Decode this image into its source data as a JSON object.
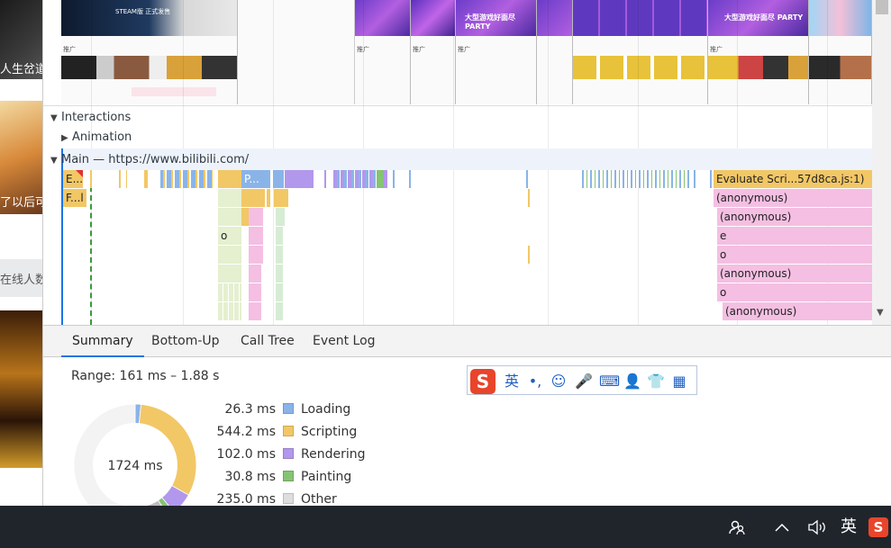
{
  "left_page": {
    "texts": [
      "人生岔道",
      "了以后可",
      "在线人数"
    ]
  },
  "filmstrip": {
    "frames": [
      {
        "banner": "STEAM版 正式发售",
        "tag": "推广"
      },
      {
        "banner": "大型游戏好面尽 PARTY",
        "tag": "推广"
      },
      {
        "banner": "大型游戏好面尽 PARTY",
        "tag": "推广"
      },
      {
        "banner": "大型游戏好面尽 PARTY",
        "tag": "推广"
      },
      {
        "banner": "大型游戏好面尽 PARTY",
        "tag": "推广"
      }
    ]
  },
  "tracks": {
    "interactions": "Interactions",
    "animation": "Animation",
    "main": "Main — https://www.bilibili.com/"
  },
  "flame": {
    "row0_left": "E...)",
    "row0_mid": "P...",
    "row1_left": "F...l",
    "row3_o": "o",
    "right_blocks": [
      "Evaluate Scri...57d8ca.js:1)",
      "(anonymous)",
      "(anonymous)",
      "e",
      "o",
      "(anonymous)",
      "o",
      "(anonymous)"
    ]
  },
  "tabs": [
    "Summary",
    "Bottom-Up",
    "Call Tree",
    "Event Log"
  ],
  "summary": {
    "range": "Range: 161 ms – 1.88 s",
    "total": "1724 ms",
    "rows": [
      {
        "value": "26.3 ms",
        "label": "Loading",
        "color": "#8ab4e8"
      },
      {
        "value": "544.2 ms",
        "label": "Scripting",
        "color": "#f2c766"
      },
      {
        "value": "102.0 ms",
        "label": "Rendering",
        "color": "#b298ec"
      },
      {
        "value": "30.8 ms",
        "label": "Painting",
        "color": "#84c473"
      },
      {
        "value": "235.0 ms",
        "label": "Other",
        "color": "#dedede"
      }
    ],
    "donut": {
      "loading": 26.3,
      "scripting": 544.2,
      "rendering": 102.0,
      "painting": 30.8,
      "other": 235.0,
      "idle": 785.7
    }
  },
  "ime": {
    "logo": "S",
    "items": [
      "英",
      "•,",
      "☺",
      "🎤",
      "⌨",
      "👤",
      "👕",
      "▦"
    ]
  },
  "taskbar": {
    "lang": "英",
    "icons": [
      "people-icon",
      "chevron-up-icon",
      "volume-icon",
      "sogou-icon"
    ]
  }
}
